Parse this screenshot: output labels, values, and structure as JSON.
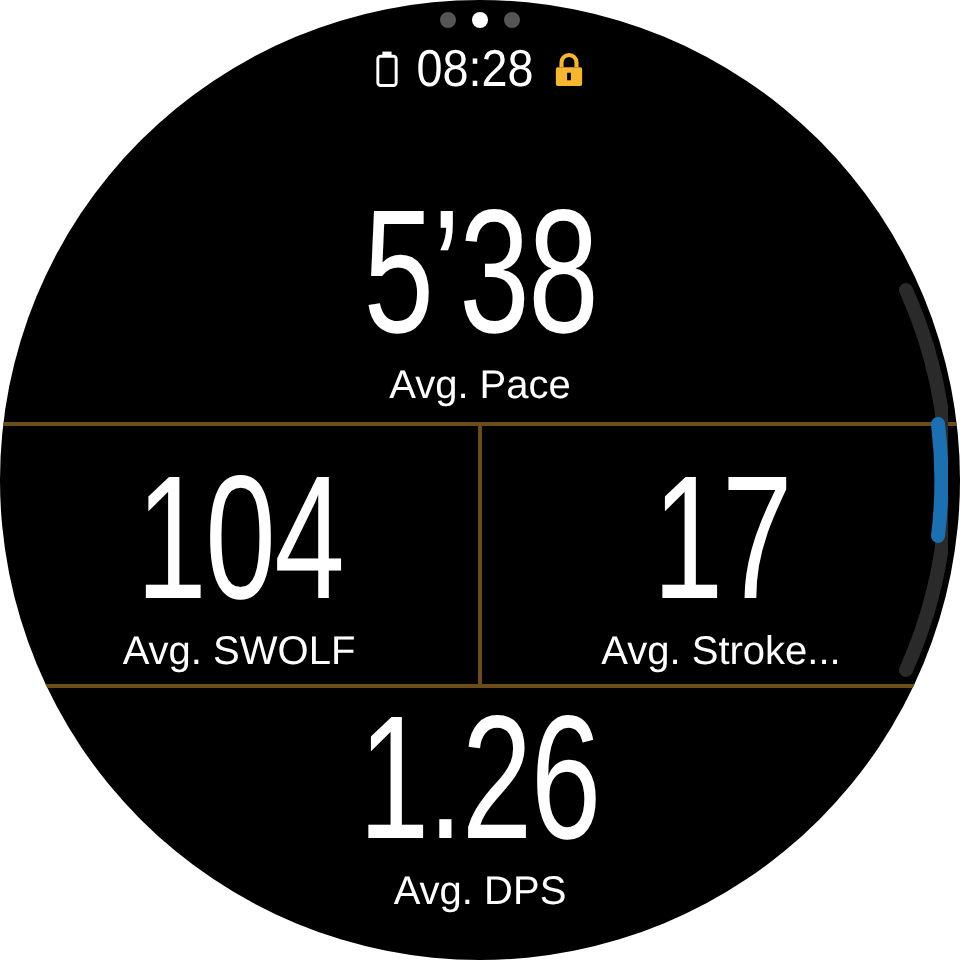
{
  "pages": [
    {
      "selected": false
    },
    {
      "selected": true
    },
    {
      "selected": false
    }
  ],
  "status_bar": {
    "time": "08:28",
    "locked": true
  },
  "metrics": [
    {
      "value": "5’38",
      "label": "Avg. Pace"
    },
    {
      "value": "104",
      "label": "Avg. SWOLF"
    },
    {
      "value": "17",
      "label": "Avg. Stroke..."
    },
    {
      "value": "1.26",
      "label": "Avg. DPS"
    }
  ]
}
